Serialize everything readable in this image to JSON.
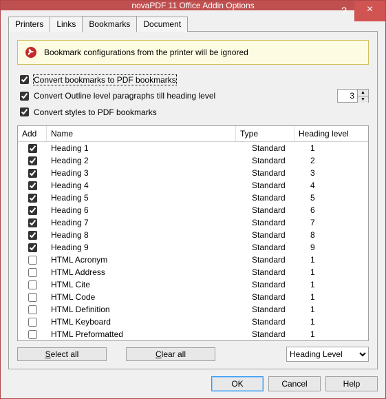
{
  "window": {
    "title": "novaPDF 11 Office Addin Options",
    "help_symbol": "?",
    "close_symbol": "×"
  },
  "tabs": [
    {
      "label": "Printers"
    },
    {
      "label": "Links"
    },
    {
      "label": "Bookmarks"
    },
    {
      "label": "Document"
    }
  ],
  "banner": {
    "text": "Bookmark configurations from the printer will be ignored"
  },
  "options": {
    "convert_bookmarks": {
      "label": "Convert bookmarks to PDF bookmarks",
      "checked": true
    },
    "convert_outline": {
      "label": "Convert Outline level paragraphs till heading level",
      "checked": true,
      "level_value": "3"
    },
    "convert_styles": {
      "label": "Convert styles to PDF bookmarks",
      "checked": true
    }
  },
  "table": {
    "headers": {
      "add": "Add",
      "name": "Name",
      "type": "Type",
      "level": "Heading level"
    },
    "rows": [
      {
        "add": true,
        "name": "Heading 1",
        "type": "Standard",
        "level": "1"
      },
      {
        "add": true,
        "name": "Heading 2",
        "type": "Standard",
        "level": "2"
      },
      {
        "add": true,
        "name": "Heading 3",
        "type": "Standard",
        "level": "3"
      },
      {
        "add": true,
        "name": "Heading 4",
        "type": "Standard",
        "level": "4"
      },
      {
        "add": true,
        "name": "Heading 5",
        "type": "Standard",
        "level": "5"
      },
      {
        "add": true,
        "name": "Heading 6",
        "type": "Standard",
        "level": "6"
      },
      {
        "add": true,
        "name": "Heading 7",
        "type": "Standard",
        "level": "7"
      },
      {
        "add": true,
        "name": "Heading 8",
        "type": "Standard",
        "level": "8"
      },
      {
        "add": true,
        "name": "Heading 9",
        "type": "Standard",
        "level": "9"
      },
      {
        "add": false,
        "name": "HTML Acronym",
        "type": "Standard",
        "level": "1"
      },
      {
        "add": false,
        "name": "HTML Address",
        "type": "Standard",
        "level": "1"
      },
      {
        "add": false,
        "name": "HTML Cite",
        "type": "Standard",
        "level": "1"
      },
      {
        "add": false,
        "name": "HTML Code",
        "type": "Standard",
        "level": "1"
      },
      {
        "add": false,
        "name": "HTML Definition",
        "type": "Standard",
        "level": "1"
      },
      {
        "add": false,
        "name": "HTML Keyboard",
        "type": "Standard",
        "level": "1"
      },
      {
        "add": false,
        "name": "HTML Preformatted",
        "type": "Standard",
        "level": "1"
      }
    ]
  },
  "buttons": {
    "select_all": "Select all",
    "clear_all": "Clear all",
    "filter_options": [
      "Heading Level"
    ],
    "filter_value": "Heading Level"
  },
  "footer": {
    "ok": "OK",
    "cancel": "Cancel",
    "help": "Help"
  }
}
